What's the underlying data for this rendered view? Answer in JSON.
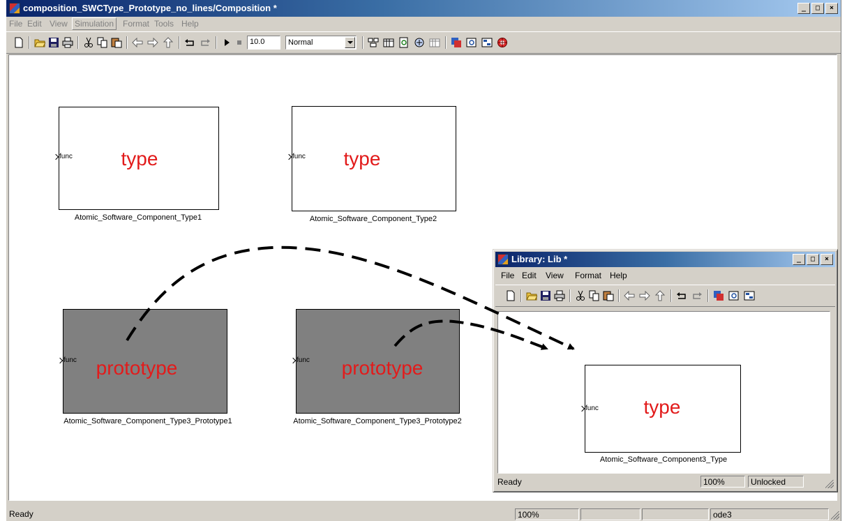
{
  "main_window": {
    "title": "composition_SWCType_Prototype_no_lines/Composition *",
    "buttons": {
      "minimize": "_",
      "maximize": "□",
      "close": "×"
    },
    "menu": [
      "File",
      "Edit",
      "View",
      "Simulation",
      "Format",
      "Tools",
      "Help"
    ],
    "toolbar": {
      "stop_time": "10.0",
      "sim_mode": "Normal",
      "icons": [
        "new-icon",
        "open-icon",
        "save-icon",
        "print-icon",
        "cut-icon",
        "copy-icon",
        "paste-icon",
        "back-icon",
        "forward-icon",
        "up-icon",
        "undo-icon",
        "redo-icon",
        "play-icon",
        "stop-icon",
        "build-icon",
        "library-browser-icon",
        "update-icon",
        "model-explorer-icon",
        "debugger-icon",
        "simulink-icon",
        "inspect-icon",
        "diagram-icon",
        "target-icon"
      ]
    },
    "status": {
      "left": "Ready",
      "zoom": "100%",
      "solver": "ode3"
    }
  },
  "blocks": {
    "type1": {
      "label": "type",
      "port": "func",
      "name": "Atomic_Software_Component_Type1"
    },
    "type2": {
      "label": "type",
      "port": "func",
      "name": "Atomic_Software_Component_Type2"
    },
    "proto1": {
      "label": "prototype",
      "port": "func",
      "name": "Atomic_Software_Component_Type3_Prototype1"
    },
    "proto2": {
      "label": "prototype",
      "port": "func",
      "name": "Atomic_Software_Component_Type3_Prototype2"
    }
  },
  "library_window": {
    "title": "Library: Lib *",
    "buttons": {
      "minimize": "_",
      "maximize": "□",
      "close": "×"
    },
    "menu": [
      "File",
      "Edit",
      "View",
      "Format",
      "Help"
    ],
    "block": {
      "label": "type",
      "port": "func",
      "name": "Atomic_Software_Component3_Type"
    },
    "status": {
      "left": "Ready",
      "zoom": "100%",
      "lock": "Unlocked"
    }
  },
  "colors": {
    "annotation_red": "#e21b1b",
    "prototype_fill": "#808080",
    "titlebar": "#0a246a"
  }
}
